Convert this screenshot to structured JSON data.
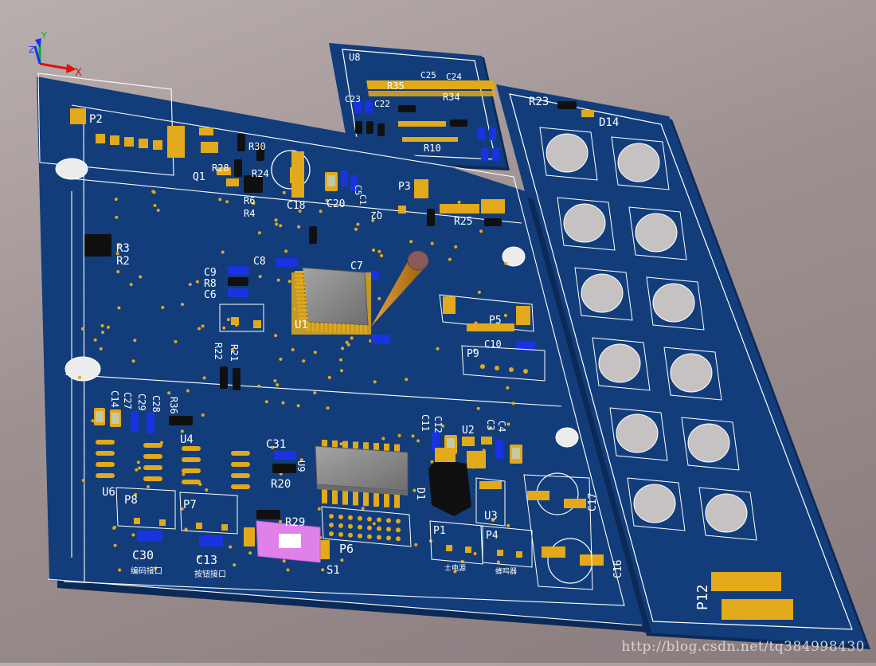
{
  "app": {
    "view": "3D PCB layout view",
    "watermark": "http://blog.csdn.net/tq384998430"
  },
  "colors": {
    "background": "#a39797",
    "board": "#123d7a",
    "board_edge": "#0c2a57",
    "silkscreen": "#ffffff",
    "pad": "#e2a91a",
    "smd_blue": "#1a33e0",
    "smd_black": "#101010",
    "chip_body": "#8d8d8d",
    "switch_body": "#e080ea",
    "probe": "#c8860c",
    "axis_x": "#e01010",
    "axis_y": "#10b020",
    "axis_z": "#1030ff"
  },
  "axis": {
    "x_label": "X",
    "y_label": "Y",
    "z_label": "Z"
  },
  "main_board": {
    "designators": [
      {
        "id": "p2",
        "text": "P2"
      },
      {
        "id": "r30",
        "text": "R30"
      },
      {
        "id": "r28",
        "text": "R28"
      },
      {
        "id": "r24",
        "text": "R24"
      },
      {
        "id": "q1",
        "text": "Q1"
      },
      {
        "id": "r6",
        "text": "R6"
      },
      {
        "id": "r4",
        "text": "R4"
      },
      {
        "id": "c18",
        "text": "C18"
      },
      {
        "id": "c20",
        "text": "C20"
      },
      {
        "id": "c5",
        "text": "C5"
      },
      {
        "id": "c1",
        "text": "C1"
      },
      {
        "id": "p3",
        "text": "P3"
      },
      {
        "id": "q2",
        "text": "Q2"
      },
      {
        "id": "r25",
        "text": "R25"
      },
      {
        "id": "r3",
        "text": "R3"
      },
      {
        "id": "r2",
        "text": "R2"
      },
      {
        "id": "c8",
        "text": "C8"
      },
      {
        "id": "c7",
        "text": "C7"
      },
      {
        "id": "c9",
        "text": "C9"
      },
      {
        "id": "r8",
        "text": "R8"
      },
      {
        "id": "c6",
        "text": "C6"
      },
      {
        "id": "u1",
        "text": "U1"
      },
      {
        "id": "p5",
        "text": "P5"
      },
      {
        "id": "c10",
        "text": "C10"
      },
      {
        "id": "p9",
        "text": "P9"
      },
      {
        "id": "r22",
        "text": "R22"
      },
      {
        "id": "r21",
        "text": "R21"
      },
      {
        "id": "c14",
        "text": "C14"
      },
      {
        "id": "c27",
        "text": "C27"
      },
      {
        "id": "c29",
        "text": "C29"
      },
      {
        "id": "c28",
        "text": "C28"
      },
      {
        "id": "r36",
        "text": "R36"
      },
      {
        "id": "u4",
        "text": "U4"
      },
      {
        "id": "u6",
        "text": "U6"
      },
      {
        "id": "c31",
        "text": "C31"
      },
      {
        "id": "u9",
        "text": "U9"
      },
      {
        "id": "r20",
        "text": "R20"
      },
      {
        "id": "c11",
        "text": "C11"
      },
      {
        "id": "c12",
        "text": "C12"
      },
      {
        "id": "u2",
        "text": "U2"
      },
      {
        "id": "c3",
        "text": "C3"
      },
      {
        "id": "c4",
        "text": "C4"
      },
      {
        "id": "d1",
        "text": "D1"
      },
      {
        "id": "u3",
        "text": "U3"
      },
      {
        "id": "c17",
        "text": "C17"
      },
      {
        "id": "p8",
        "text": "P8"
      },
      {
        "id": "p7",
        "text": "P7"
      },
      {
        "id": "r29",
        "text": "R29"
      },
      {
        "id": "p6",
        "text": "P6"
      },
      {
        "id": "s1",
        "text": "S1"
      },
      {
        "id": "p1",
        "text": "P1"
      },
      {
        "id": "p4",
        "text": "P4"
      },
      {
        "id": "c16",
        "text": "C16"
      },
      {
        "id": "c30",
        "text": "C30"
      },
      {
        "id": "c13",
        "text": "C13"
      }
    ],
    "chinese_labels": {
      "p8_caption": "编码接口",
      "p7_caption": "按钮接口",
      "p1_caption": "士电源",
      "p4_caption": "蜂鸣器"
    }
  },
  "top_board": {
    "designators": [
      {
        "id": "u8",
        "text": "U8"
      },
      {
        "id": "r35",
        "text": "R35"
      },
      {
        "id": "c25",
        "text": "C25"
      },
      {
        "id": "c24",
        "text": "C24"
      },
      {
        "id": "r34",
        "text": "R34"
      },
      {
        "id": "c23",
        "text": "C23"
      },
      {
        "id": "c22",
        "text": "C22"
      },
      {
        "id": "r10",
        "text": "R10"
      }
    ]
  },
  "side_board": {
    "designators": [
      {
        "id": "r23",
        "text": "R23"
      },
      {
        "id": "d14",
        "text": "D14"
      },
      {
        "id": "p12",
        "text": "P12"
      }
    ],
    "key_holes": 12
  }
}
